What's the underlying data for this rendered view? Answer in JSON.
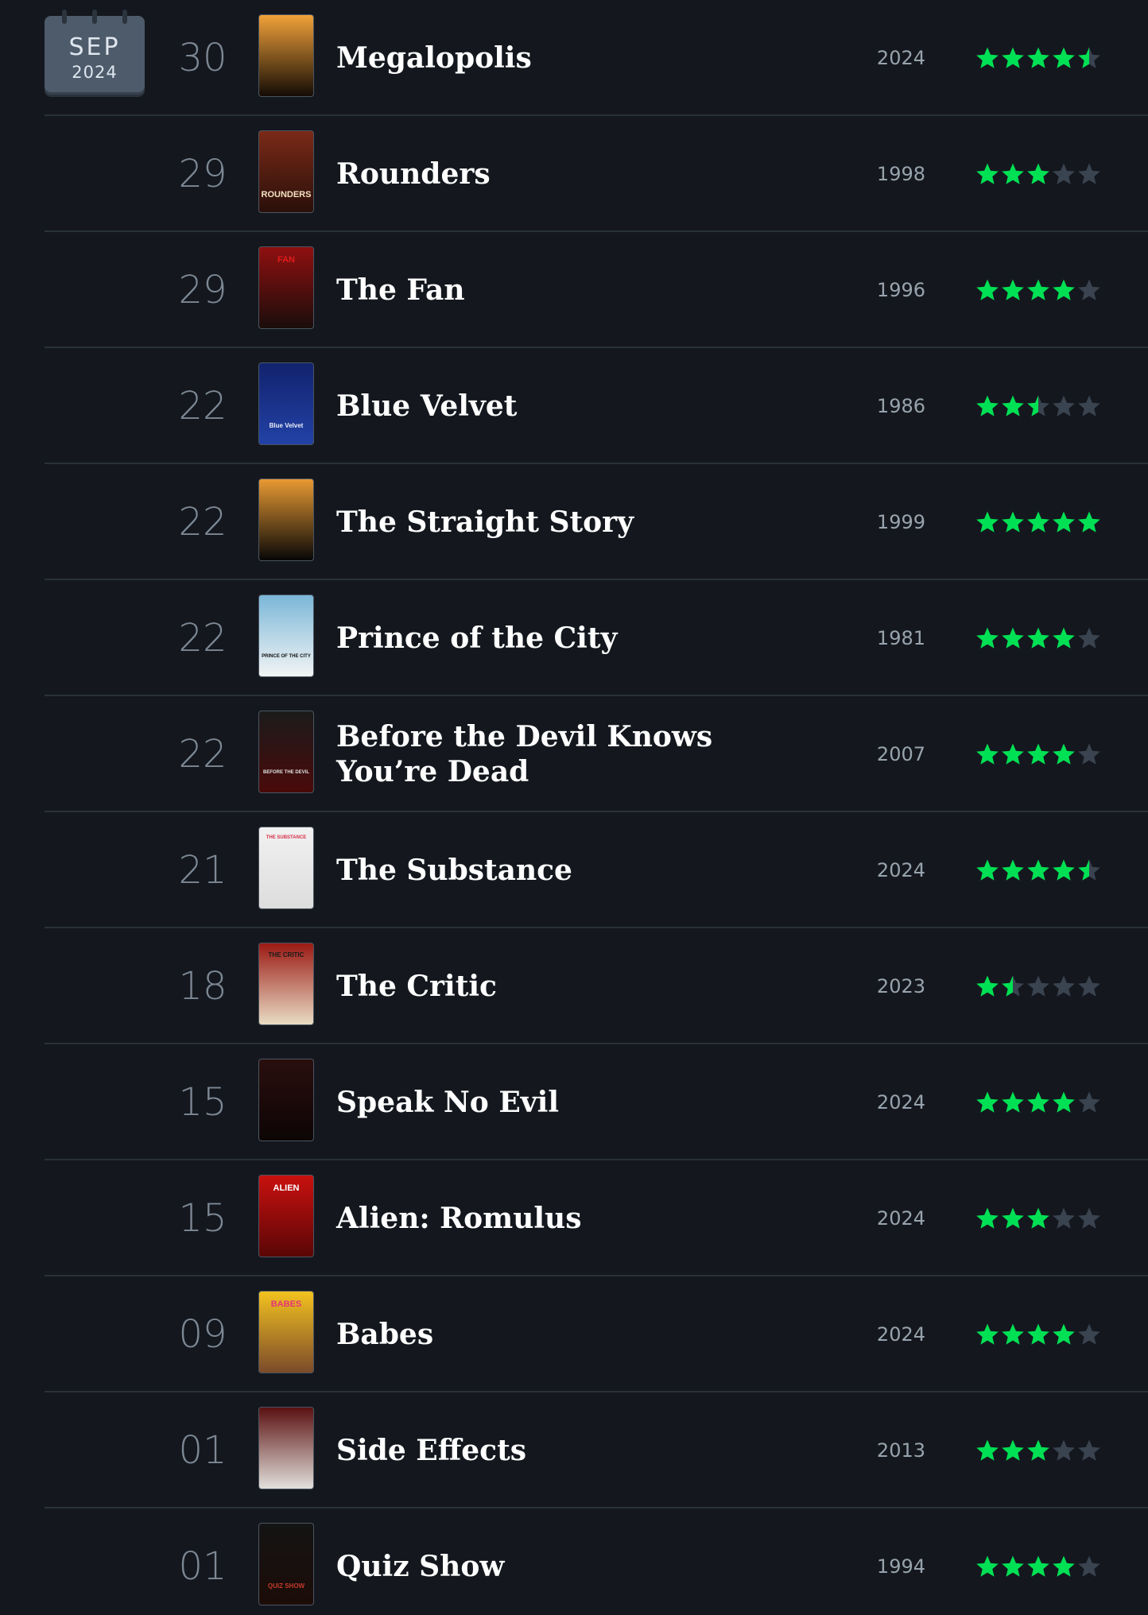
{
  "calendar": {
    "month": "SEP",
    "year": "2024"
  },
  "colors": {
    "background": "#14181e",
    "divider": "#2a313a",
    "star_filled": "#00e054",
    "star_empty": "#3a4350",
    "calendar_badge": "#4d5b6b"
  },
  "entries": [
    {
      "day": "30",
      "title": "Megalopolis",
      "year": "2024",
      "rating": 4.5,
      "poster": {
        "top": "#f2a23a",
        "bottom": "#140c05",
        "text": "",
        "text_color": "#ffd27a"
      }
    },
    {
      "day": "29",
      "title": "Rounders",
      "year": "1998",
      "rating": 3,
      "poster": {
        "top": "#7a2a17",
        "bottom": "#2a0f0a",
        "text": "ROUNDERS",
        "text_color": "#f3e3c3"
      }
    },
    {
      "day": "29",
      "title": "The Fan",
      "year": "1996",
      "rating": 4,
      "poster": {
        "top": "#8f1010",
        "bottom": "#1a0d0b",
        "text": "FAN",
        "text_color": "#e11b1b"
      }
    },
    {
      "day": "22",
      "title": "Blue Velvet",
      "year": "1986",
      "rating": 2.5,
      "poster": {
        "top": "#12226e",
        "bottom": "#2242a6",
        "text": "Blue Velvet",
        "text_color": "#e9eef8"
      }
    },
    {
      "day": "22",
      "title": "The Straight Story",
      "year": "1999",
      "rating": 5,
      "poster": {
        "top": "#e89a33",
        "bottom": "#070707",
        "text": "",
        "text_color": "#cfcfcf"
      }
    },
    {
      "day": "22",
      "title": "Prince of the City",
      "year": "1981",
      "rating": 4,
      "poster": {
        "top": "#7bb7d8",
        "bottom": "#f2f4f4",
        "text": "PRINCE OF THE CITY",
        "text_color": "#111111"
      }
    },
    {
      "day": "22",
      "title": "Before the Devil Knows You’re Dead",
      "year": "2007",
      "rating": 4,
      "poster": {
        "top": "#1b1b1b",
        "bottom": "#4a0a0a",
        "text": "BEFORE THE DEVIL",
        "text_color": "#e0e0e0"
      }
    },
    {
      "day": "21",
      "title": "The Substance",
      "year": "2024",
      "rating": 4.5,
      "poster": {
        "top": "#f1f1f1",
        "bottom": "#dddddd",
        "text": "THE SUBSTANCE",
        "text_color": "#d8324b"
      }
    },
    {
      "day": "18",
      "title": "The Critic",
      "year": "2023",
      "rating": 1.5,
      "poster": {
        "top": "#9b1a14",
        "bottom": "#e9dcc4",
        "text": "THE CRITIC",
        "text_color": "#1a1a1a"
      }
    },
    {
      "day": "15",
      "title": "Speak No Evil",
      "year": "2024",
      "rating": 4,
      "poster": {
        "top": "#2a0e0e",
        "bottom": "#0d0505",
        "text": "",
        "text_color": "#cccccc"
      }
    },
    {
      "day": "15",
      "title": "Alien: Romulus",
      "year": "2024",
      "rating": 3,
      "poster": {
        "top": "#c8110f",
        "bottom": "#5a0606",
        "text": "ALIEN",
        "text_color": "#ffffff"
      }
    },
    {
      "day": "09",
      "title": "Babes",
      "year": "2024",
      "rating": 4,
      "poster": {
        "top": "#f3c21f",
        "bottom": "#7b4a2a",
        "text": "BABES",
        "text_color": "#e5337a"
      }
    },
    {
      "day": "01",
      "title": "Side Effects",
      "year": "2013",
      "rating": 3,
      "poster": {
        "top": "#5a1111",
        "bottom": "#e2e0db",
        "text": "",
        "text_color": "#333333"
      }
    },
    {
      "day": "01",
      "title": "Quiz Show",
      "year": "1994",
      "rating": 4,
      "poster": {
        "top": "#141414",
        "bottom": "#1c0c08",
        "text": "QUIZ SHOW",
        "text_color": "#c23a2a"
      }
    }
  ]
}
